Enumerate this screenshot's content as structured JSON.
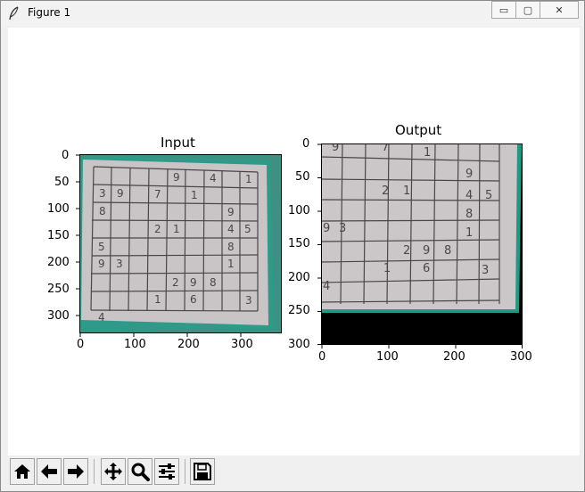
{
  "window": {
    "title": "Figure 1",
    "minimize_glyph": "▭",
    "maximize_glyph": "▢",
    "close_glyph": "✕"
  },
  "plots": [
    {
      "title": "Input",
      "x_ticks": [
        "0",
        "100",
        "200",
        "300"
      ],
      "y_ticks": [
        "0",
        "50",
        "100",
        "150",
        "200",
        "250",
        "300"
      ]
    },
    {
      "title": "Output",
      "x_ticks": [
        "0",
        "100",
        "200",
        "300"
      ],
      "y_ticks": [
        "0",
        "50",
        "100",
        "150",
        "200",
        "250",
        "300"
      ]
    }
  ],
  "sudoku_digits": [
    "9",
    "4",
    "1",
    "3",
    "9",
    "7",
    "1",
    "8",
    "9",
    "2",
    "1",
    "4",
    "5",
    "5",
    "8",
    "9",
    "3",
    "1",
    "2",
    "9",
    "8",
    "1",
    "6",
    "3",
    "4"
  ],
  "toolbar": {
    "buttons": [
      "home-icon",
      "back-icon",
      "forward-icon",
      "pan-icon",
      "zoom-icon",
      "configure-subplots-icon",
      "save-icon"
    ]
  },
  "colors": {
    "board_bg": "#5b5857",
    "paper": "#c7c3c4",
    "teal": "#2e9a86",
    "black": "#000000"
  }
}
